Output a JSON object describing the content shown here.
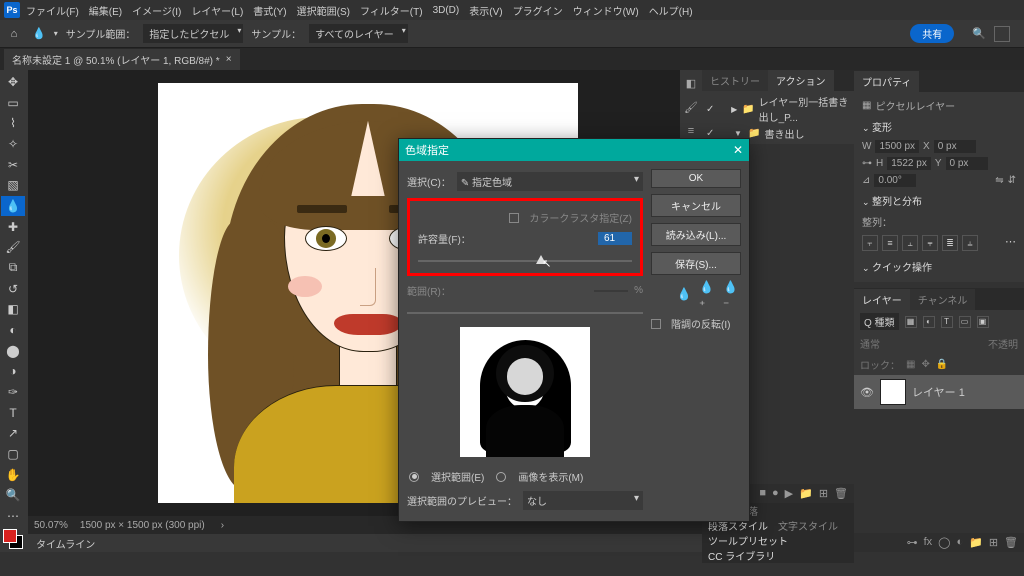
{
  "menubar": {
    "ps": "Ps",
    "items": [
      "ファイル(F)",
      "編集(E)",
      "イメージ(I)",
      "レイヤー(L)",
      "書式(Y)",
      "選択範囲(S)",
      "フィルター(T)",
      "3D(D)",
      "表示(V)",
      "プラグイン",
      "ウィンドウ(W)",
      "ヘルプ(H)"
    ]
  },
  "options": {
    "sample_label": "サンプル範囲：",
    "sample_value": "指定したピクセル",
    "sample2_label": "サンプル：",
    "sample2_value": "すべてのレイヤー",
    "share": "共有"
  },
  "doc_tab": {
    "title": "名称未設定 1 @ 50.1% (レイヤー 1, RGB/8#) *"
  },
  "status": {
    "zoom": "50.07%",
    "dims": "1500 px × 1500 px (300 ppi)"
  },
  "timeline": {
    "label": "タイムライン"
  },
  "history_panel": {
    "tab_history": "ヒストリー",
    "tab_actions": "アクション",
    "actions": [
      {
        "label": "レイヤー別一括書き出し_P...",
        "expanded": false,
        "folder": true
      },
      {
        "label": "書き出し",
        "expanded": true,
        "folder": true
      }
    ]
  },
  "properties_panel": {
    "tab": "プロパティ",
    "layer_type": "ピクセルレイヤー",
    "sect_transform": "変形",
    "w_lbl": "W",
    "w_val": "1500 px",
    "x_lbl": "X",
    "x_val": "0 px",
    "h_lbl": "H",
    "h_val": "1522 px",
    "y_lbl": "Y",
    "y_val": "0 px",
    "angle_lbl": "⊿",
    "angle_val": "0.00°",
    "sect_align": "整列と分布",
    "align_lbl": "整列：",
    "sect_quick": "クイック操作"
  },
  "layers_panel": {
    "tab_layers": "レイヤー",
    "tab_channels": "チャンネル",
    "filter_label": "Q 種類",
    "mode": "通常",
    "opacity_lbl": "不透明",
    "lock_lbl": "ロック：",
    "layer_name": "レイヤー 1"
  },
  "bottom_panels": {
    "text": "文字",
    "para": "段落",
    "para_style": "段落スタイル",
    "text_style": "文字スタイル",
    "tool_preset": "ツールプリセット",
    "cc_lib": "CC ライブラリ"
  },
  "dialog": {
    "title": "色域指定",
    "select_lbl": "選択(C)：",
    "select_val": "✎ 指定色域",
    "detect_face": "カラークラスタ指定(Z)",
    "fuzz_lbl": "許容量(F)：",
    "fuzz_val": "61",
    "range_lbl": "範囲(R)：",
    "ok": "OK",
    "cancel": "キャンセル",
    "load": "読み込み(L)...",
    "save": "保存(S)...",
    "invert": "階調の反転(I)",
    "radio_sel": "選択範囲(E)",
    "radio_img": "画像を表示(M)",
    "preview_lbl": "選択範囲のプレビュー：",
    "preview_val": "なし"
  }
}
